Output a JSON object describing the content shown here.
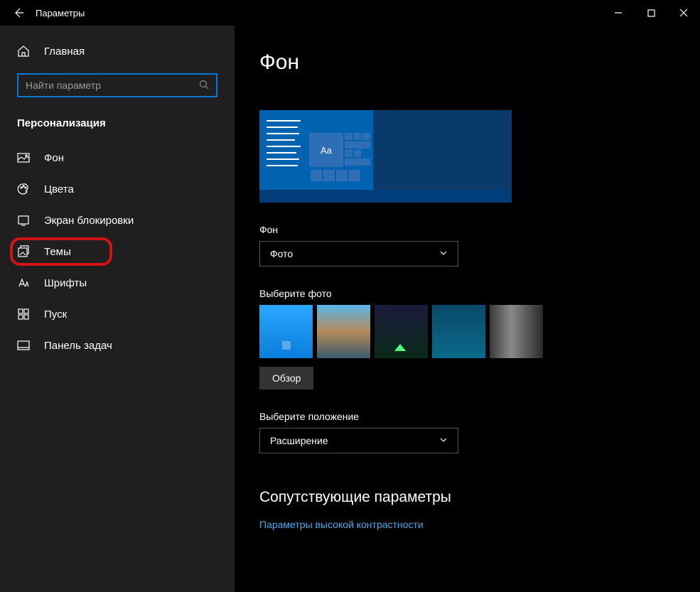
{
  "window": {
    "title": "Параметры"
  },
  "home": {
    "label": "Главная"
  },
  "search": {
    "placeholder": "Найти параметр"
  },
  "category": {
    "label": "Персонализация"
  },
  "nav": [
    {
      "id": "background",
      "label": "Фон"
    },
    {
      "id": "colors",
      "label": "Цвета"
    },
    {
      "id": "lockscreen",
      "label": "Экран блокировки"
    },
    {
      "id": "themes",
      "label": "Темы"
    },
    {
      "id": "fonts",
      "label": "Шрифты"
    },
    {
      "id": "start",
      "label": "Пуск"
    },
    {
      "id": "taskbar",
      "label": "Панель задач"
    }
  ],
  "page": {
    "title": "Фон",
    "preview_tile": "Aa",
    "bg_label": "Фон",
    "bg_value": "Фото",
    "choose_label": "Выберите фото",
    "browse": "Обзор",
    "fit_label": "Выберите положение",
    "fit_value": "Расширение",
    "related_title": "Сопутствующие параметры",
    "related_link": "Параметры высокой контрастности"
  }
}
